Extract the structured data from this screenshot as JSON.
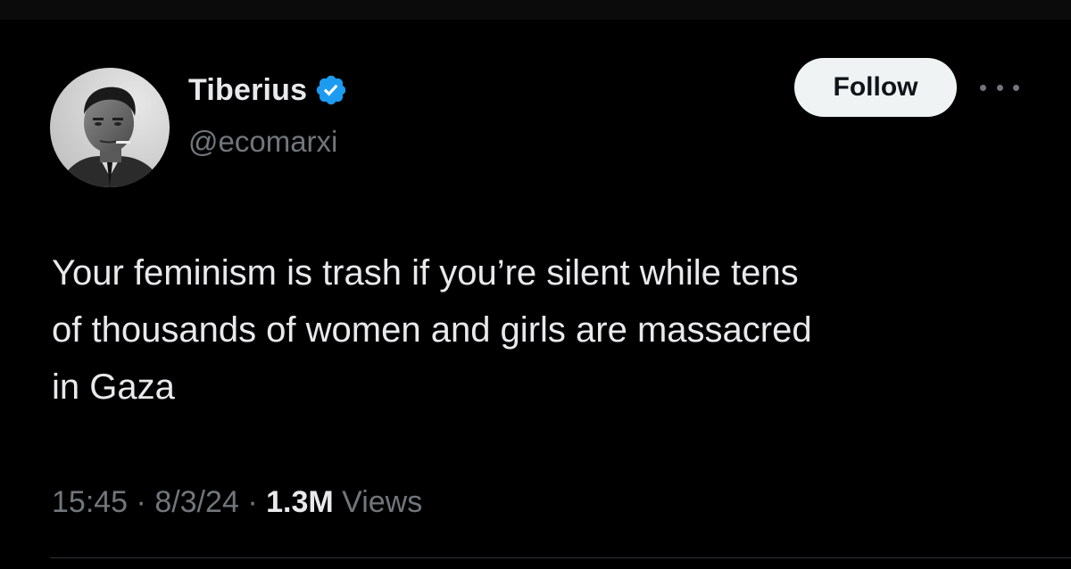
{
  "tweet": {
    "author": {
      "display_name": "Tiberius",
      "handle": "@ecomarxi",
      "verified": true,
      "avatar_icon": "portrait-photo"
    },
    "follow_label": "Follow",
    "more_icon": "more-horizontal-icon",
    "text": "Your feminism is trash if you’re silent while tens\nof thousands of women and girls are massacred\nin Gaza",
    "time": "15:45",
    "date": "8/3/24",
    "separator": "·",
    "views_count": "1.3M",
    "views_label": "Views"
  },
  "colors": {
    "background": "#000000",
    "primary_text": "#e7e9ea",
    "secondary_text": "#71767b",
    "verified_badge": "#1d9bf0",
    "follow_button_bg": "#eff3f4",
    "follow_button_text": "#0f1419",
    "divider": "#2f3336"
  }
}
